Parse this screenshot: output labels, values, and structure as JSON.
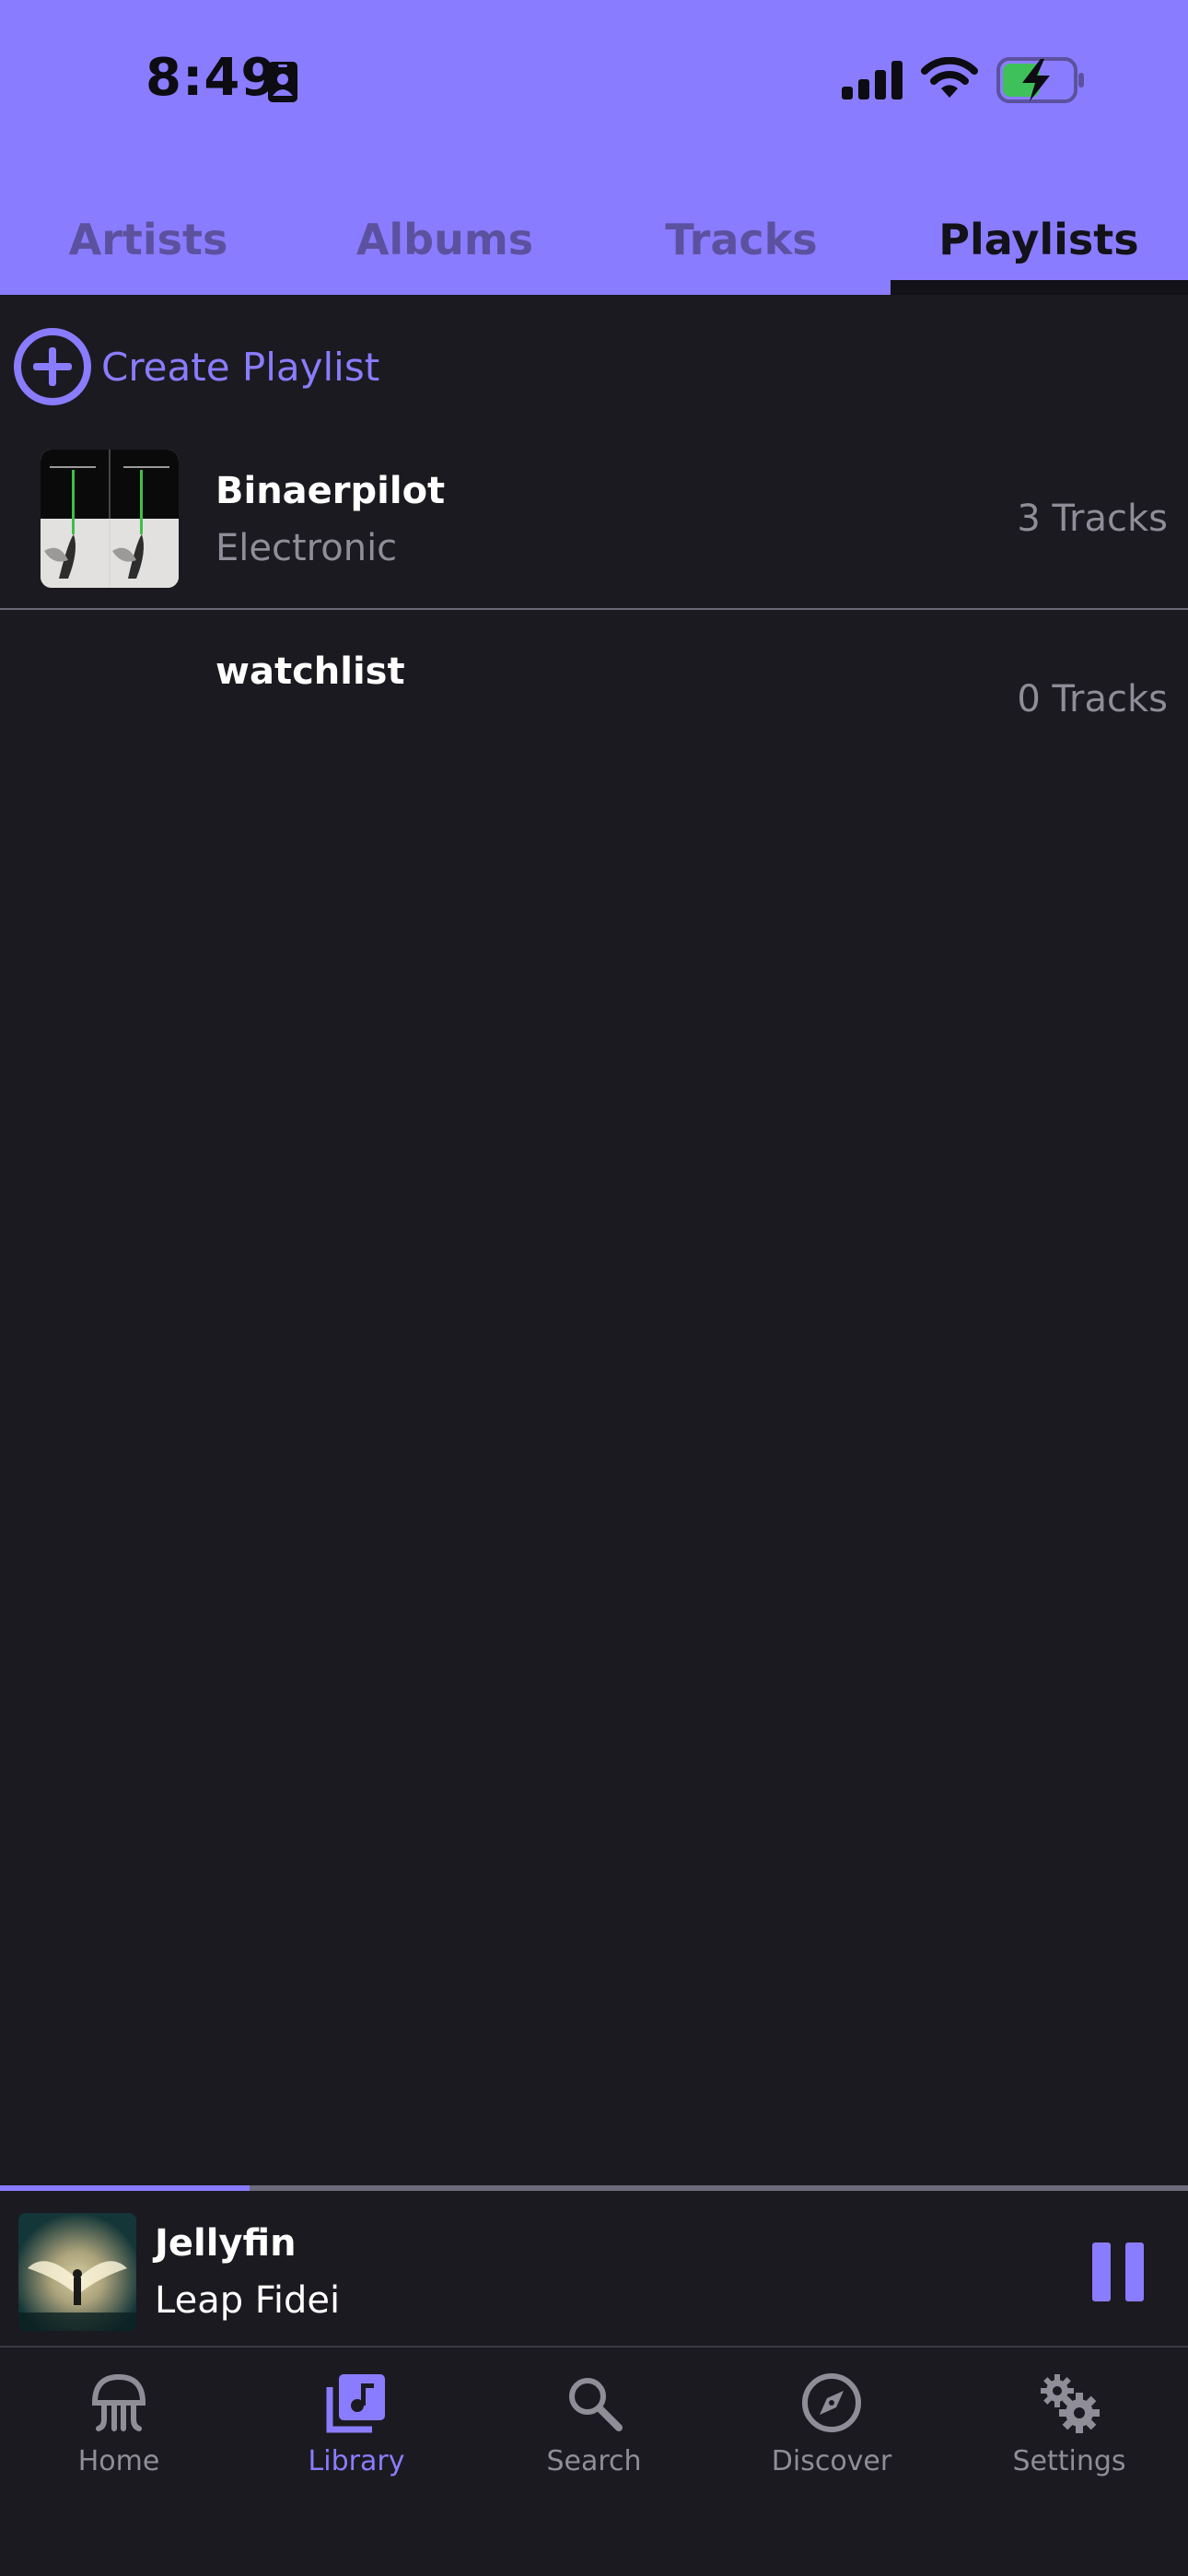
{
  "status_bar": {
    "time": "8:49"
  },
  "tabs": [
    {
      "label": "Artists",
      "active": false
    },
    {
      "label": "Albums",
      "active": false
    },
    {
      "label": "Tracks",
      "active": false
    },
    {
      "label": "Playlists",
      "active": true
    }
  ],
  "create_playlist": {
    "label": "Create Playlist",
    "icon": "plus-circle-icon"
  },
  "playlists": [
    {
      "name": "Binaerpilot",
      "genre": "Electronic",
      "count": "3 Tracks"
    },
    {
      "name": "watchlist",
      "genre": "",
      "count": "0 Tracks"
    }
  ],
  "now_playing": {
    "title": "Jellyfin",
    "artist": "Leap Fidei",
    "progress": 0.21
  },
  "bottom_nav": [
    {
      "label": "Home",
      "icon": "jellyfish-icon",
      "active": false
    },
    {
      "label": "Library",
      "icon": "library-music-icon",
      "active": true
    },
    {
      "label": "Search",
      "icon": "search-icon",
      "active": false
    },
    {
      "label": "Discover",
      "icon": "compass-icon",
      "active": false
    },
    {
      "label": "Settings",
      "icon": "gears-icon",
      "active": false
    }
  ],
  "colors": {
    "accent": "#8a7cff",
    "background": "#1b1a20",
    "muted_text": "#8f8d97"
  }
}
